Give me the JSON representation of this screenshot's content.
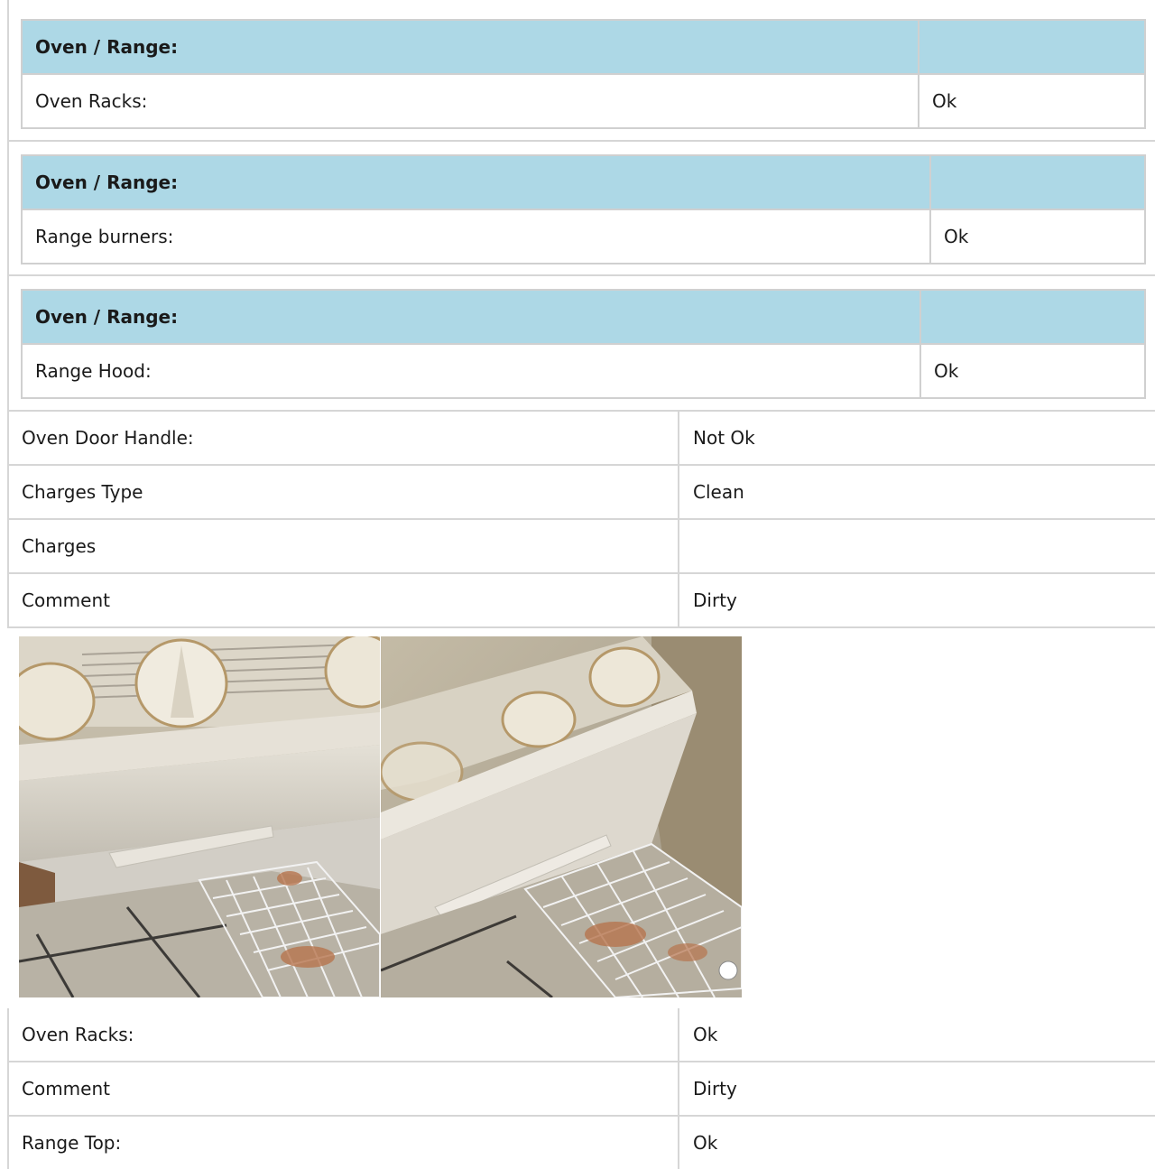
{
  "sections": [
    {
      "header": "Oven / Range:",
      "item": "Oven Racks:",
      "value": "Ok"
    },
    {
      "header": "Oven / Range:",
      "item": "Range burners:",
      "value": "Ok"
    },
    {
      "header": "Oven / Range:",
      "item": "Range Hood:",
      "value": "Ok"
    }
  ],
  "details": [
    {
      "label": "Oven Door Handle:",
      "value": "Not Ok"
    },
    {
      "label": "Charges Type",
      "value": "Clean"
    },
    {
      "label": "Charges",
      "value": ""
    },
    {
      "label": "Comment",
      "value": "Dirty"
    }
  ],
  "photos": [
    {
      "name": "oven-knobs-photo-1"
    },
    {
      "name": "oven-knobs-photo-2"
    }
  ],
  "details2": [
    {
      "label": "Oven Racks:",
      "value": "Ok"
    },
    {
      "label": "Comment",
      "value": "Dirty"
    },
    {
      "label": "Range Top:",
      "value": "Ok"
    }
  ]
}
